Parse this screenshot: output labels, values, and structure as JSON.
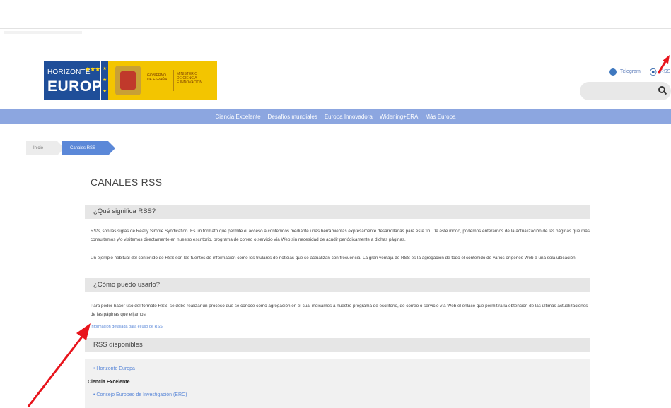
{
  "brand": {
    "logo_line1": "HORIZONTE",
    "logo_line2": "EUROPA",
    "gov_left": "GOBIERNO\nDE ESPAÑA",
    "gov_right": "MINISTERIO\nDE CIENCIA\nE INNOVACIÓN"
  },
  "header": {
    "telegram": "Telegram",
    "rss": "RSS",
    "search_placeholder": ""
  },
  "nav": {
    "items": [
      "Ciencia Excelente",
      "Desafíos mundiales",
      "Europa Innovadora",
      "Widening+ERA",
      "Más Europa"
    ]
  },
  "breadcrumb": {
    "home": "Inicio",
    "current": "Canales RSS"
  },
  "content": {
    "title": "CANALES RSS",
    "section1": "¿Qué significa RSS?",
    "p1": "RSS, son las siglas de Really Simple Syndication. Es un formato que permite el acceso a contenidos mediante unas herramientas expresamente desarrolladas para este fin. De este modo, podemos enterarnos de la actualización de las páginas que más consultemos y/o visitemos directamente en nuestro escritorio, programa de correo o servicio vía Web sin necesidad de acudir periódicamente a dichas páginas.",
    "p2": "Un ejemplo habitual del contenido de RSS son las fuentes de información como los titulares de noticias que se actualizan con frecuencia. La gran ventaja de RSS es la agregación de todo el contenido de varios orígenes Web a una sola ubicación.",
    "section2": "¿Cómo puedo usarlo?",
    "p3": "Para poder hacer uso del formato RSS, se debe realizar un proceso que se conoce como agregación en el cual indicamos a nuestro programa de escritorio, de correo o servicio vía Web el enlace que permitirá la obtención de las últimas actualizaciones de las páginas que elijamos.",
    "info_link": "Información detallada para el uso de RSS.",
    "section3": "RSS disponibles",
    "feed1": "Horizonte Europa",
    "category1": "Ciencia Excelente",
    "feed2_partial": "Consejo Europeo de Investigación (ERC)"
  },
  "colors": {
    "nav_bg": "#8ca6e0",
    "accent_blue": "#5b88d8",
    "annotation_red": "#e8141c"
  }
}
